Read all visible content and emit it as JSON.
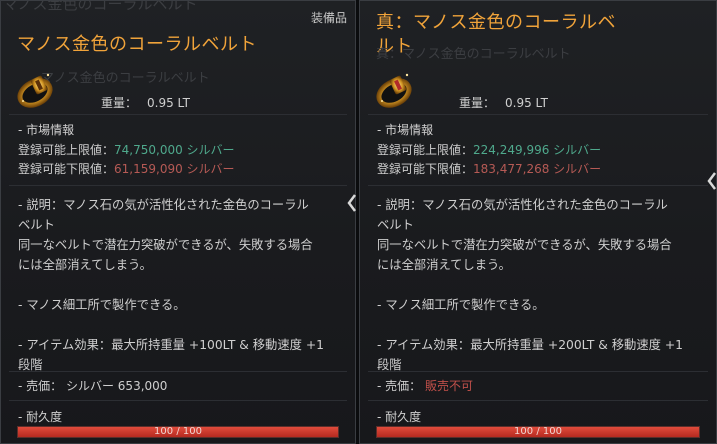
{
  "left": {
    "ghost_top": "マノス金色のコーラルベルト",
    "category": "装備品",
    "title_line1": "マノス金色のコーラルベルト",
    "ghost_sub": "マノス金色のコーラルベルト",
    "weight_label": "重量：",
    "weight_value": "0.95 LT",
    "market_header": "- 市場情報",
    "max_label": "登録可能上限値：",
    "max_value": "74,750,000 シルバー",
    "min_label": "登録可能下限値：",
    "min_value": "61,159,090 シルバー",
    "desc": [
      "- 説明：マノス石の気が活性化された金色のコーラル",
      "ベルト",
      "同一なベルトで潜在力突破ができるが、失敗する場合",
      "には全部消えてしまう。",
      "",
      "- マノス細工所で製作できる。",
      "",
      "- アイテム効果：最大所持重量 +100LT & 移動速度 +1",
      "段階"
    ],
    "price_label": "- 売価：",
    "price_value": "シルバー 653,000",
    "durability_label": "- 耐久度",
    "durability_text": "100 / 100",
    "durability_fraction": 1.0
  },
  "right": {
    "title_line1": "真：マノス金色のコーラルベ",
    "title_line2": "ルト",
    "ghost_sub": "真：マノス金色のコーラルベルト",
    "weight_label": "重量：",
    "weight_value": "0.95 LT",
    "market_header": "- 市場情報",
    "max_label": "登録可能上限値：",
    "max_value": "224,249,996 シルバー",
    "min_label": "登録可能下限値：",
    "min_value": "183,477,268 シルバー",
    "desc": [
      "- 説明：マノス石の気が活性化された金色のコーラル",
      "ベルト",
      "同一なベルトで潜在力突破ができるが、失敗する場合",
      "には全部消えてしまう。",
      "",
      "- マノス細工所で製作できる。",
      "",
      "- アイテム効果：最大所持重量 +200LT & 移動速度 +1",
      "段階"
    ],
    "price_label": "- 売価：",
    "price_value": "販売不可",
    "durability_label": "- 耐久度",
    "durability_text": "100 / 100",
    "durability_fraction": 1.0
  },
  "colors": {
    "title": "#f0a33a",
    "market_value_green": "#4fa98c",
    "market_value_red": "#b65a55",
    "not_for_sale": "#c0504a",
    "durability_bar": "#d13a2c"
  },
  "icons": [
    "item-belt-icon",
    "compare-arrow-left-icon",
    "compare-arrow-right-icon"
  ]
}
